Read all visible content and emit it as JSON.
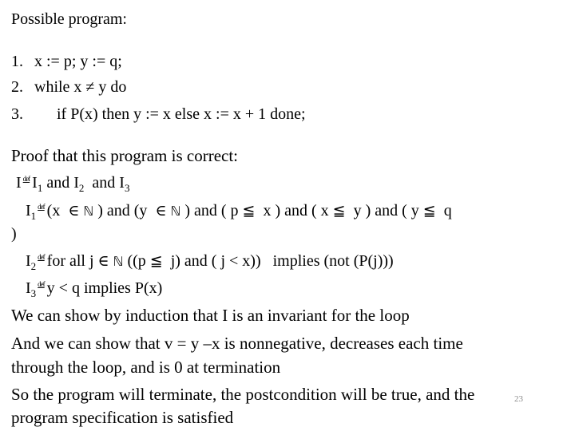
{
  "title": "Possible program:",
  "program": [
    {
      "num": "1.",
      "code": "x := p; y := q;"
    },
    {
      "num": "2.",
      "code": "while x ≠ y do"
    },
    {
      "num": "3.",
      "code": "if P(x) then y := x else x := x + 1 done;"
    }
  ],
  "proof_heading": "Proof that this program is correct:",
  "defs": {
    "def_symbol": "def",
    "naturals": "ℕ",
    "elem": "∈",
    "leq": "≦",
    "I": {
      "lhs": "I",
      "parts": [
        "I",
        "1",
        " and I",
        "2",
        "  and I",
        "3"
      ]
    },
    "I1": {
      "lhs": "I",
      "lhs_sub": "1",
      "text_a": "(x  ",
      "text_b": " ) and (y  ",
      "text_c": " ) and ( p ",
      "text_d": "  x ) and ( x ",
      "text_e": "  y ) and ( y ",
      "text_f": "  q",
      "closing": ")"
    },
    "I2": {
      "lhs": "I",
      "lhs_sub": "2",
      "text_a": "for all j ",
      "text_b": " ((p ",
      "text_c": "  j) and ( j < x))   implies (not (P(j)))"
    },
    "I3": {
      "lhs": "I",
      "lhs_sub": "3",
      "text": "y < q implies P(x)"
    }
  },
  "paragraphs": [
    "We can show by induction that I is an invariant for the loop",
    "And we can show that v = y –x is nonnegative, decreases each time",
    "through the loop, and is 0 at termination",
    "So the program will terminate, the postcondition will be true, and the",
    "program specification is satisfied"
  ],
  "page_number": "23"
}
